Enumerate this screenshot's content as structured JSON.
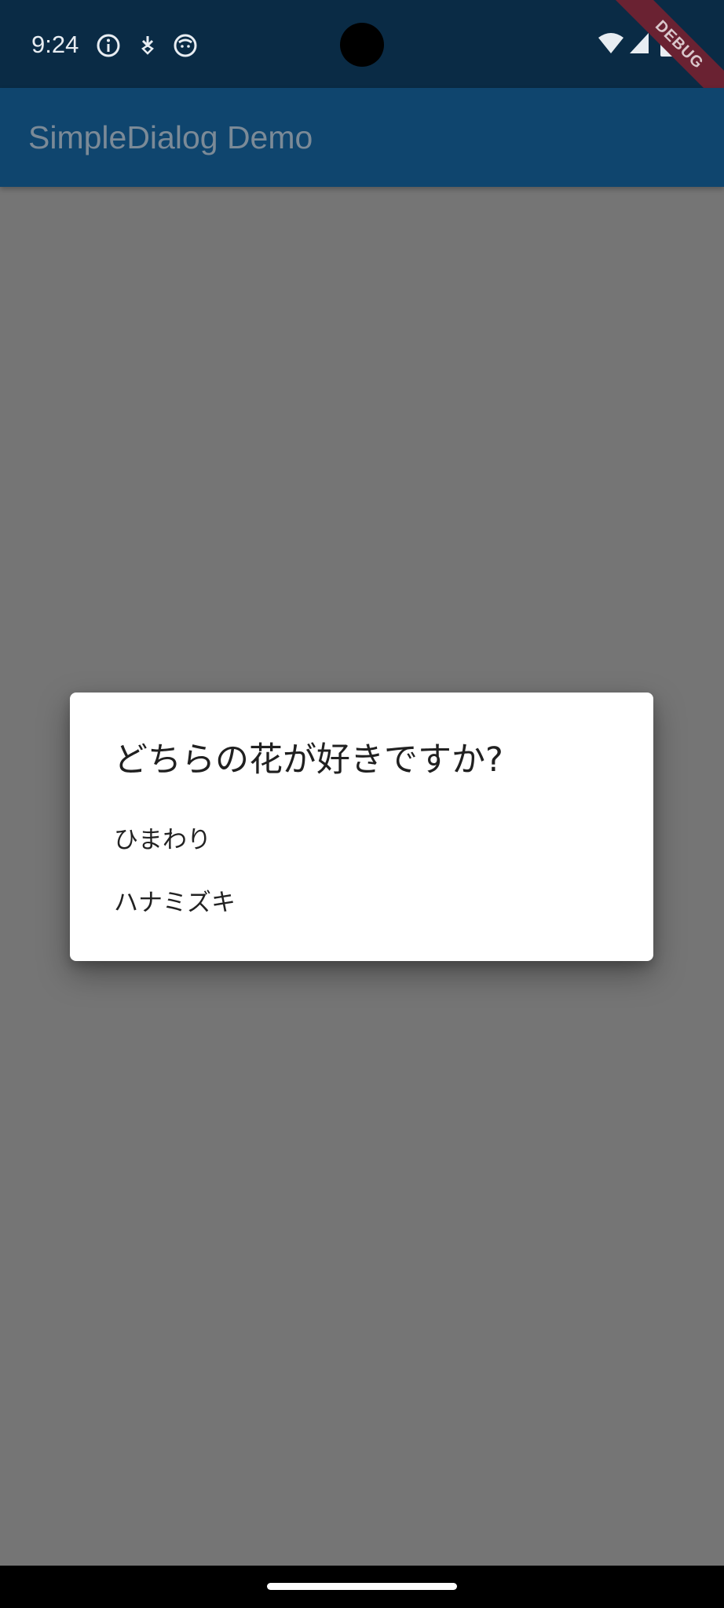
{
  "status_bar": {
    "time": "9:24",
    "icons": [
      "info-icon",
      "download-icon",
      "face-icon",
      "wifi-icon",
      "signal-icon",
      "battery-icon"
    ]
  },
  "debug_banner": "DEBUG",
  "app_bar": {
    "title": "SimpleDialog Demo"
  },
  "dialog": {
    "title": "どちらの花が好きですか?",
    "options": [
      {
        "label": "ひまわり"
      },
      {
        "label": "ハナミズキ"
      }
    ]
  },
  "colors": {
    "status_bar": "#0a2b45",
    "app_bar": "#0f456e",
    "scrim_background": "#757575",
    "dialog_background": "#ffffff",
    "debug_ribbon": "#6a2232"
  }
}
